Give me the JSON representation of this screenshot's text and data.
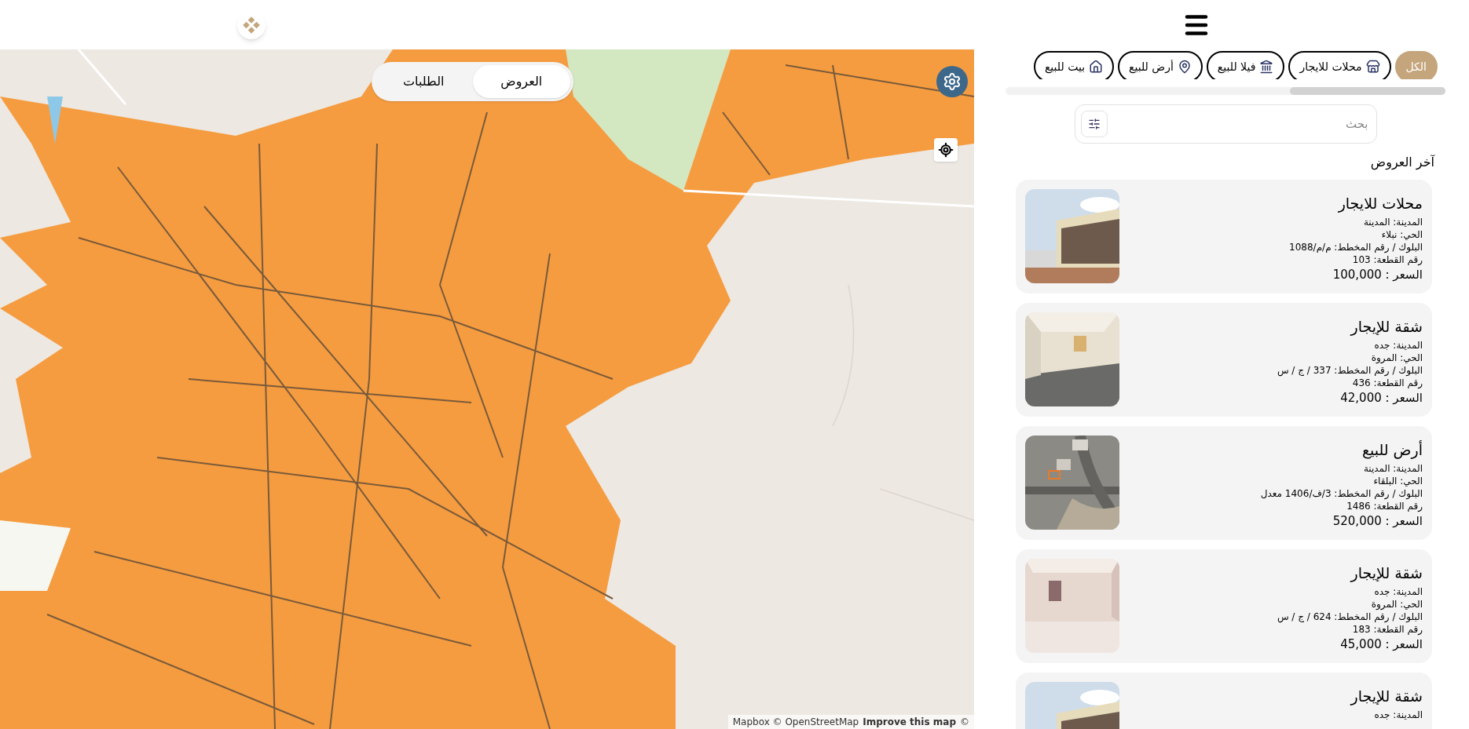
{
  "map": {
    "tabs": [
      {
        "label": "العروض",
        "selected": true
      },
      {
        "label": "الطلبات",
        "selected": false
      }
    ],
    "attribution": {
      "credits": "Mapbox © OpenStreetMap",
      "link": "Improve this map",
      "mark": "©"
    }
  },
  "categories": [
    {
      "label": "الكل",
      "kind": "none",
      "selected": true
    },
    {
      "label": "محلات للايجار",
      "kind": "store",
      "selected": false
    },
    {
      "label": "فيلا للبيع",
      "kind": "villa",
      "selected": false
    },
    {
      "label": "أرض للبيع",
      "kind": "pin",
      "selected": false
    },
    {
      "label": "بيت للبيع",
      "kind": "house",
      "selected": false
    }
  ],
  "search": {
    "placeholder": "بحث"
  },
  "section_title": "آخر العروض",
  "listings": [
    {
      "title": "محلات للايجار",
      "details": [
        "المدينة: المدينة",
        "الحي: نبلاء",
        "البلوك / رقم المخطط: م/م/1088",
        "رقم القطعة: 103"
      ],
      "price": "السعر : 100,000"
    },
    {
      "title": "شقة للإيجار",
      "details": [
        "المدينة: جده",
        "الحي: المروة",
        "البلوك / رقم المخطط: 337 / ج / س",
        "رقم القطعة: 436"
      ],
      "price": "السعر : 42,000"
    },
    {
      "title": "أرض للبيع",
      "details": [
        "المدينة: المدينة",
        "الحي: البلقاء",
        "البلوك / رقم المخطط: 3/ف/1406 معدل",
        "رقم القطعة: 1486"
      ],
      "price": "السعر : 520,000"
    },
    {
      "title": "شقة للإيجار",
      "details": [
        "المدينة: جده",
        "الحي: المروة",
        "البلوك / رقم المخطط: 624 / ج / س",
        "رقم القطعة: 183"
      ],
      "price": "السعر : 45,000"
    },
    {
      "title": "شقة للإيجار",
      "details": [
        "المدينة: جده"
      ]
    }
  ]
}
